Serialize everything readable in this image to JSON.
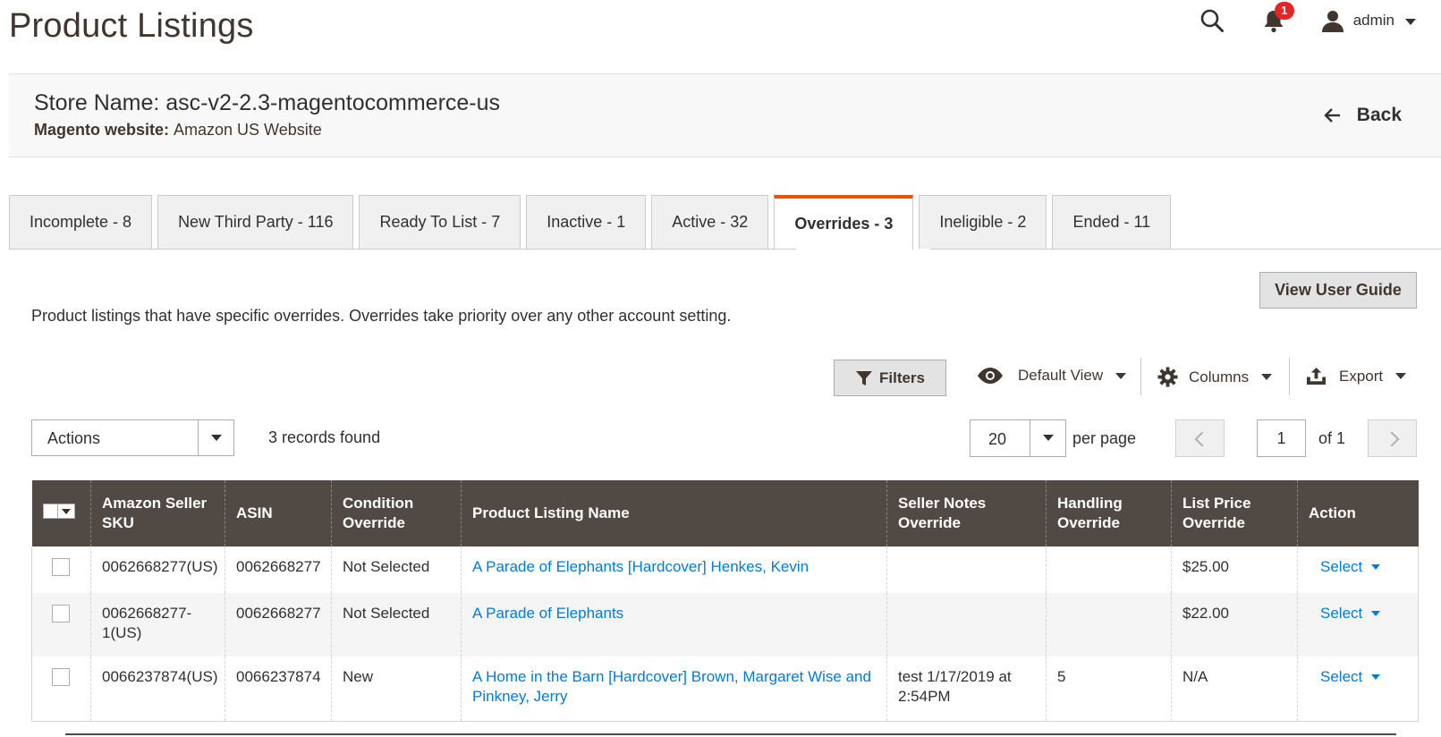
{
  "header": {
    "title": "Product Listings",
    "notification_count": "1",
    "user_name": "admin"
  },
  "store": {
    "name": "Store Name: asc-v2-2.3-magentocommerce-us",
    "website_label": "Magento website:",
    "website_value": "Amazon US Website",
    "back_label": "Back"
  },
  "tabs": [
    {
      "label": "Incomplete - 8",
      "active": false
    },
    {
      "label": "New Third Party - 116",
      "active": false
    },
    {
      "label": "Ready To List - 7",
      "active": false
    },
    {
      "label": "Inactive - 1",
      "active": false
    },
    {
      "label": "Active - 32",
      "active": false
    },
    {
      "label": "Overrides - 3",
      "active": true
    },
    {
      "label": "Ineligible - 2",
      "active": false
    },
    {
      "label": "Ended - 11",
      "active": false
    }
  ],
  "description": "Product listings that have specific overrides. Overrides take priority over any other account setting.",
  "view_guide_label": "View User Guide",
  "toolbar": {
    "filters_label": "Filters",
    "view_label": "Default View",
    "columns_label": "Columns",
    "export_label": "Export"
  },
  "actions_label": "Actions",
  "records_found": "3 records found",
  "pagination": {
    "per_page_value": "20",
    "per_page_label": "per page",
    "current_page": "1",
    "total_label": "of 1"
  },
  "grid": {
    "columns": [
      "Amazon Seller SKU",
      "ASIN",
      "Condition Override",
      "Product Listing Name",
      "Seller Notes Override",
      "Handling Override",
      "List Price Override",
      "Action"
    ],
    "rows": [
      {
        "sku": "0062668277(US)",
        "asin": "0062668277",
        "condition": "Not Selected",
        "name": "A Parade of Elephants [Hardcover] Henkes, Kevin",
        "notes": "",
        "handling": "",
        "price": "$25.00",
        "action": "Select"
      },
      {
        "sku": "0062668277-1(US)",
        "asin": "0062668277",
        "condition": "Not Selected",
        "name": "A Parade of Elephants",
        "notes": "",
        "handling": "",
        "price": "$22.00",
        "action": "Select"
      },
      {
        "sku": "0066237874(US)",
        "asin": "0066237874",
        "condition": "New",
        "name": "A Home in the Barn [Hardcover] Brown, Margaret Wise and Pinkney, Jerry",
        "notes": "test 1/17/2019 at 2:54PM",
        "handling": "5",
        "price": "N/A",
        "action": "Select"
      }
    ]
  },
  "colors": {
    "accent": "#eb5202",
    "grid_header": "#514943",
    "link": "#007bdb",
    "badge": "#e22626"
  }
}
